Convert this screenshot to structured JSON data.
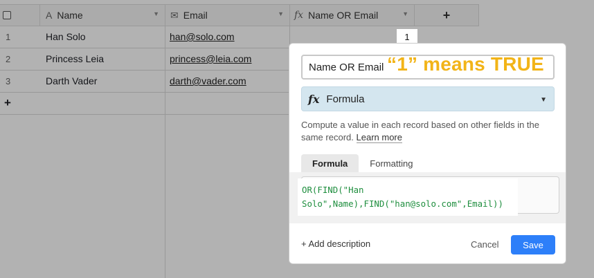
{
  "grid": {
    "columns": [
      {
        "label": "Name",
        "icon": "text-field-icon"
      },
      {
        "label": "Email",
        "icon": "email-field-icon"
      },
      {
        "label": "Name OR Email",
        "icon": "formula-icon"
      }
    ],
    "add_column_label": "+",
    "rows": [
      {
        "num": "1",
        "name": "Han Solo",
        "email": "han@solo.com"
      },
      {
        "num": "2",
        "name": "Princess Leia",
        "email": "princess@leia.com"
      },
      {
        "num": "3",
        "name": "Darth Vader",
        "email": "darth@vader.com"
      }
    ],
    "add_row_label": "+",
    "first_formula_value": "1"
  },
  "popup": {
    "field_name": "Name OR Email",
    "annotation": "“1” means TRUE",
    "field_type": "Formula",
    "description": "Compute a value in each record based on other fields in the same record.",
    "learn_more": "Learn more",
    "tabs": [
      "Formula",
      "Formatting"
    ],
    "formula_line1": "OR(FIND(\"Han",
    "formula_line2": "Solo\",Name),FIND(\"han@solo.com\",Email))",
    "add_description": "+ Add description",
    "cancel": "Cancel",
    "save": "Save"
  },
  "colors": {
    "accent": "#2d7ff9",
    "annotation": "#f2b418",
    "formula_text": "#1e8e3e",
    "type_select_bg": "#d4e6ef"
  }
}
